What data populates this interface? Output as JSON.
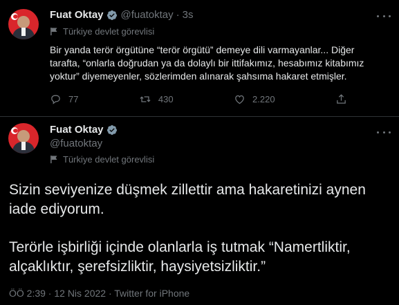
{
  "tweet1": {
    "name": "Fuat Oktay",
    "handle": "@fuatoktay",
    "separator": "·",
    "time": "3s",
    "label": "Türkiye devlet görevlisi",
    "text_line1": "Bir yanda terör örgütüne “terör örgütü” demeye dili varmayanlar... Diğer",
    "text_line2": "tarafta, “onlarla doğrudan ya da dolaylı bir ittifakımız, hesabımız kitabımız",
    "text_line3": "yoktur” diyemeyenler, sözlerimden alınarak şahsıma hakaret etmişler.",
    "replies": "77",
    "retweets": "430",
    "likes": "2.220"
  },
  "tweet2": {
    "name": "Fuat Oktay",
    "handle": "@fuatoktay",
    "label": "Türkiye devlet görevlisi",
    "para1_line1": "Sizin seviyenize düşmek zillettir ama hakaretinizi aynen",
    "para1_line2": "iade ediyorum.",
    "para2_line1": "Terörle işbirliği içinde olanlarla iş tutmak “Namertliktir,",
    "para2_line2": "alçaklıktır, şerefsizliktir, haysiyetsizliktir.”",
    "footer": "ÖÖ 2:39 · 12 Nis 2022 · Twitter for iPhone"
  },
  "colors": {
    "background": "#000000",
    "text": "#e7e9ea",
    "muted": "#71767b",
    "verified": "#829aab",
    "avatar": "#d9262b"
  },
  "icons": [
    "verified-icon",
    "flag-icon",
    "reply-icon",
    "retweet-icon",
    "like-icon",
    "share-icon",
    "more-icon"
  ]
}
